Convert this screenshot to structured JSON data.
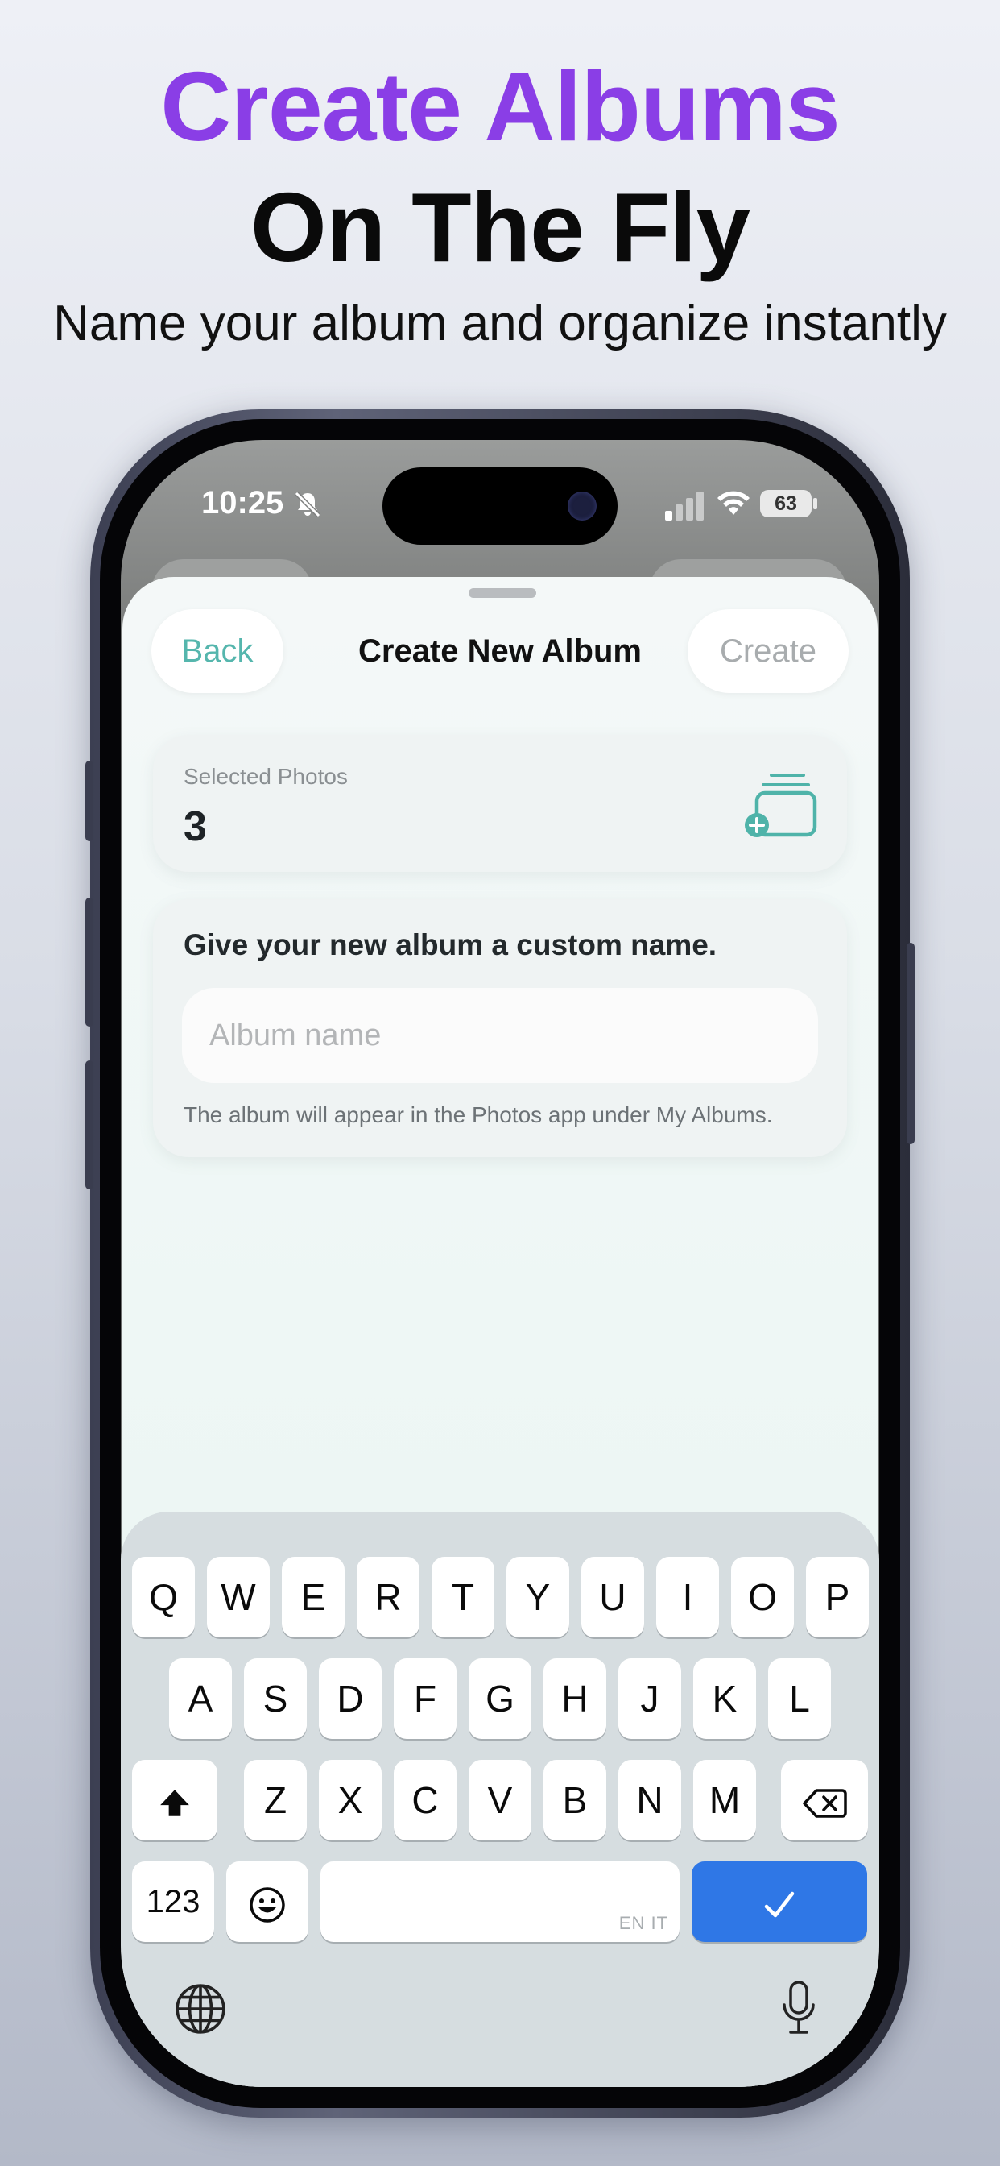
{
  "promo": {
    "headline_1": "Create Albums",
    "headline_2": "On The Fly",
    "subheadline": "Name your album and organize instantly",
    "accent_color": "#8a3ee6"
  },
  "status_bar": {
    "time": "10:25",
    "battery": "63",
    "silent_icon": "bell-slash-icon",
    "signal_icon": "cellular-signal-icon",
    "wifi_icon": "wifi-icon"
  },
  "sheet": {
    "title": "Create New Album",
    "back_label": "Back",
    "create_label": "Create",
    "accent_color": "#55b6ad"
  },
  "selected_card": {
    "label": "Selected Photos",
    "count": "3",
    "icon": "add-to-album-icon"
  },
  "name_card": {
    "prompt": "Give your new album a custom name.",
    "input_placeholder": "Album name",
    "input_value": "",
    "hint": "The album will appear in the Photos app under My Albums."
  },
  "keyboard": {
    "row1": [
      "Q",
      "W",
      "E",
      "R",
      "T",
      "Y",
      "U",
      "I",
      "O",
      "P"
    ],
    "row2": [
      "A",
      "S",
      "D",
      "F",
      "G",
      "H",
      "J",
      "K",
      "L"
    ],
    "row3": [
      "Z",
      "X",
      "C",
      "V",
      "B",
      "N",
      "M"
    ],
    "numbers_label": "123",
    "space_hint": "EN IT",
    "done_color": "#2f77e6"
  }
}
